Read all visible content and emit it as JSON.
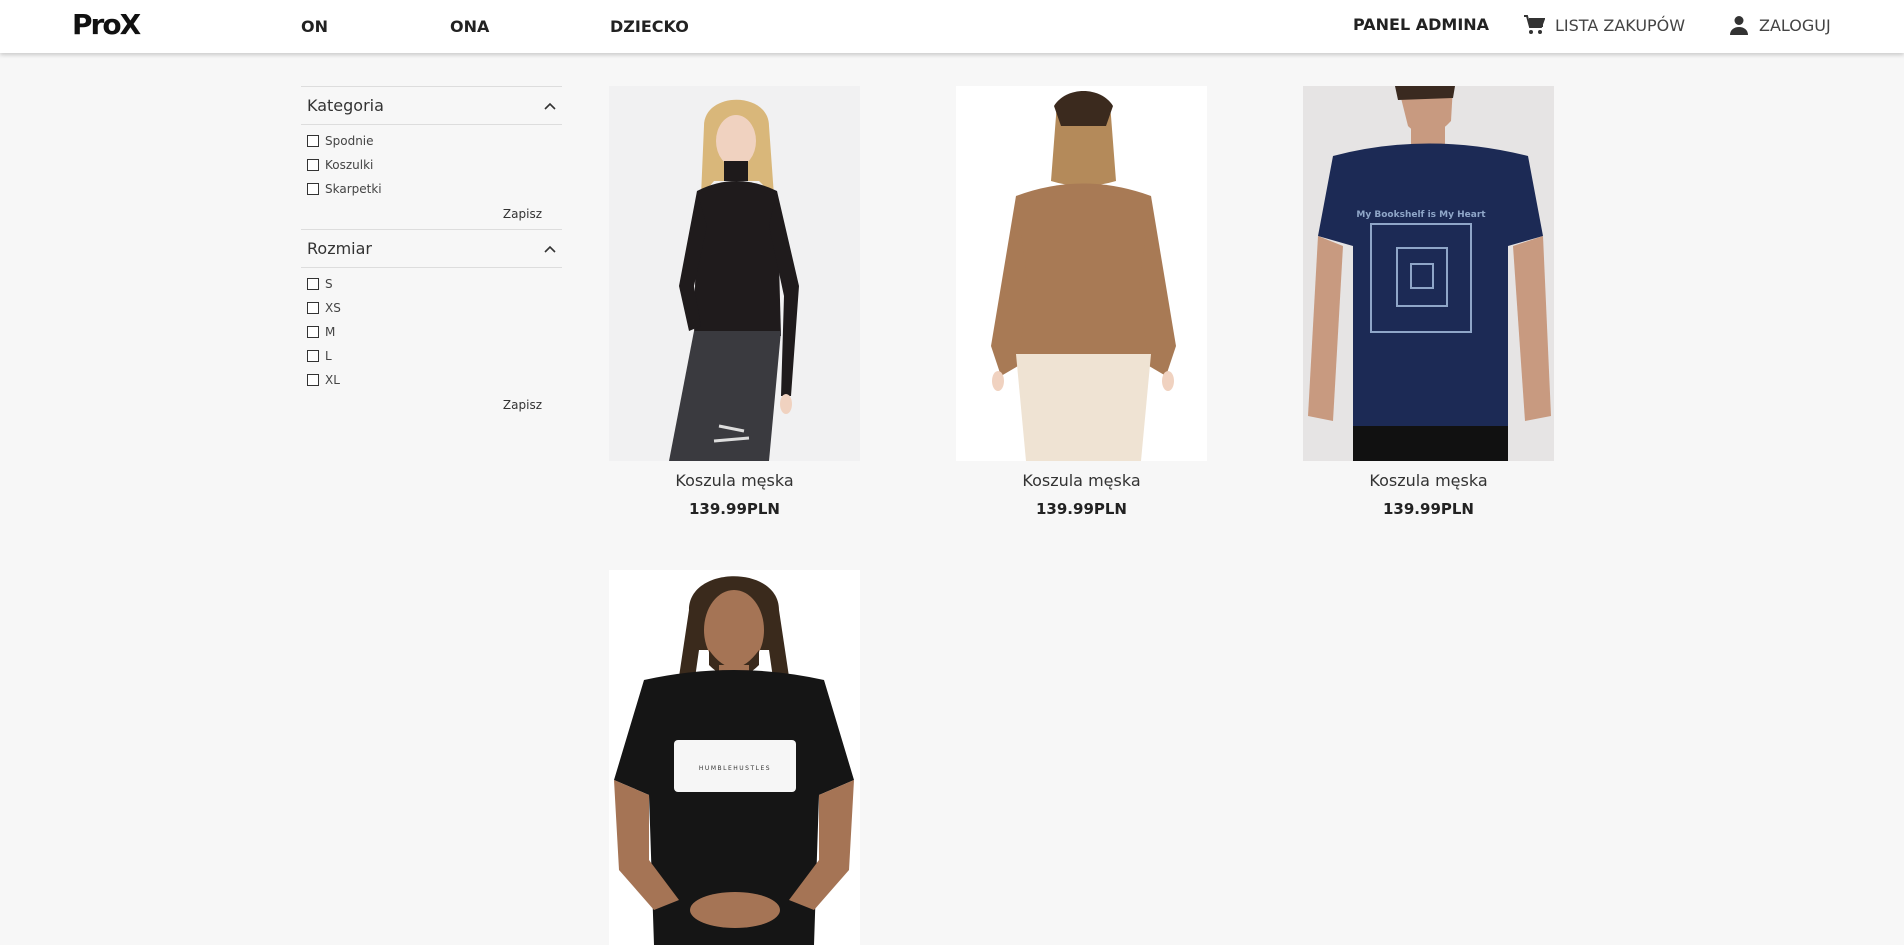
{
  "header": {
    "logo": "ProX",
    "nav": [
      {
        "label": "ON"
      },
      {
        "label": "ONA"
      },
      {
        "label": "DZIECKO"
      }
    ],
    "admin_label": "PANEL ADMINA",
    "cart_label": "LISTA ZAKUPÓW",
    "login_label": "ZALOGUJ",
    "cart_icon": "cart-icon",
    "user_icon": "user-icon"
  },
  "filters": [
    {
      "title": "Kategoria",
      "options": [
        "Spodnie",
        "Koszulki",
        "Skarpetki"
      ],
      "save_label": "Zapisz"
    },
    {
      "title": "Rozmiar",
      "options": [
        "S",
        "XS",
        "M",
        "L",
        "XL"
      ],
      "save_label": "Zapisz"
    }
  ],
  "products": [
    {
      "name": "Koszula męska",
      "price": "139.99PLN",
      "image": "woman-black-turtleneck"
    },
    {
      "name": "Koszula męska",
      "price": "139.99PLN",
      "image": "woman-brown-sweater-back"
    },
    {
      "name": "Koszula męska",
      "price": "139.99PLN",
      "image": "man-navy-tshirt"
    },
    {
      "name": "",
      "price": "",
      "image": "man-black-tshirt"
    }
  ],
  "colors": {
    "background": "#f7f7f7",
    "header": "#ffffff",
    "text": "#222222"
  }
}
